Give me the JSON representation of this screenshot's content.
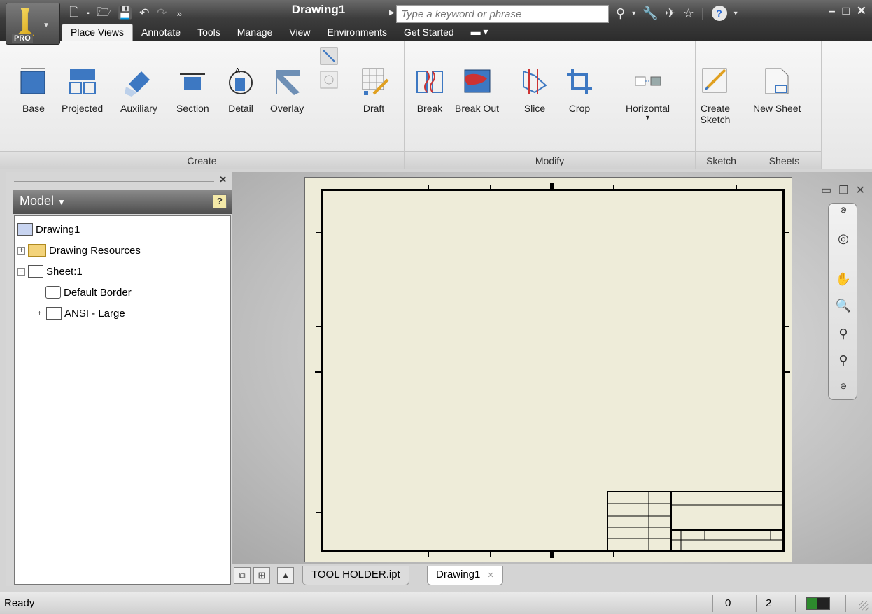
{
  "app": {
    "edition_badge": "PRO",
    "document_title": "Drawing1",
    "colors": {
      "titlebar": "#3d3d3d",
      "ribbon": "#f2f2f2",
      "sheet": "#eeecd9",
      "canvas": "#bdbdbd",
      "memory_bar": "#2d8a2d"
    }
  },
  "quick_access": {
    "icons": [
      "new-icon",
      "open-icon",
      "save-icon",
      "undo-icon",
      "redo-icon",
      "more-icon"
    ]
  },
  "search": {
    "placeholder": "Type a keyword or phrase"
  },
  "info_icons": [
    "binoculars-icon",
    "wrench-icon",
    "satellite-icon",
    "star-icon",
    "help-icon"
  ],
  "ribbon_tabs": [
    "Place Views",
    "Annotate",
    "Tools",
    "Manage",
    "View",
    "Environments",
    "Get Started"
  ],
  "ribbon": {
    "create": {
      "label": "Create",
      "buttons": [
        "Base",
        "Projected",
        "Auxiliary",
        "Section",
        "Detail",
        "Overlay",
        "Draft"
      ]
    },
    "modify": {
      "label": "Modify",
      "buttons": [
        "Break",
        "Break Out",
        "Slice",
        "Crop",
        "Horizontal"
      ]
    },
    "sketch": {
      "label": "Sketch",
      "button_line1": "Create",
      "button_line2": "Sketch"
    },
    "sheets": {
      "label": "Sheets",
      "button": "New Sheet"
    }
  },
  "browser": {
    "title": "Model",
    "help": "?",
    "tree": [
      {
        "label": "Drawing1",
        "level": 0,
        "expander": ""
      },
      {
        "label": "Drawing Resources",
        "level": 1,
        "expander": "+"
      },
      {
        "label": "Sheet:1",
        "level": 1,
        "expander": "−"
      },
      {
        "label": "Default Border",
        "level": 2,
        "expander": ""
      },
      {
        "label": "ANSI - Large",
        "level": 2,
        "expander": "+"
      }
    ]
  },
  "doc_tabs": [
    "TOOL HOLDER.ipt",
    "Drawing1"
  ],
  "status": {
    "text": "Ready",
    "value_a": "0",
    "value_b": "2"
  }
}
